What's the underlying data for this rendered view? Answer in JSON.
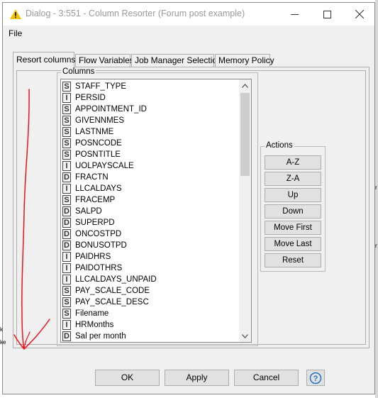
{
  "window": {
    "title": "Dialog - 3:551 - Column Resorter (Forum post example)"
  },
  "menu": {
    "file_label": "File"
  },
  "tabs": [
    {
      "label": "Resort columns",
      "active": true
    },
    {
      "label": "Flow Variables",
      "active": false
    },
    {
      "label": "Job Manager Selection",
      "active": false
    },
    {
      "label": "Memory Policy",
      "active": false
    }
  ],
  "columns_group": {
    "legend": "Columns"
  },
  "columns": [
    {
      "type": "S",
      "name": "STAFF_TYPE"
    },
    {
      "type": "I",
      "name": "PERSID"
    },
    {
      "type": "S",
      "name": "APPOINTMENT_ID"
    },
    {
      "type": "S",
      "name": "GIVENNMES"
    },
    {
      "type": "S",
      "name": "LASTNME"
    },
    {
      "type": "S",
      "name": "POSNCODE"
    },
    {
      "type": "S",
      "name": "POSNTITLE"
    },
    {
      "type": "I",
      "name": "UOLPAYSCALE"
    },
    {
      "type": "D",
      "name": "FRACTN"
    },
    {
      "type": "I",
      "name": "LLCALDAYS"
    },
    {
      "type": "S",
      "name": "FRACEMP"
    },
    {
      "type": "D",
      "name": "SALPD"
    },
    {
      "type": "D",
      "name": "SUPERPD"
    },
    {
      "type": "D",
      "name": "ONCOSTPD"
    },
    {
      "type": "D",
      "name": "BONUSOTPD"
    },
    {
      "type": "I",
      "name": "PAIDHRS"
    },
    {
      "type": "I",
      "name": "PAIDOTHRS"
    },
    {
      "type": "I",
      "name": "LLCALDAYS_UNPAID"
    },
    {
      "type": "S",
      "name": "PAY_SCALE_CODE"
    },
    {
      "type": "S",
      "name": "PAY_SCALE_DESC"
    },
    {
      "type": "S",
      "name": "Filename"
    },
    {
      "type": "I",
      "name": "HRMonths"
    },
    {
      "type": "D",
      "name": "Sal per month"
    }
  ],
  "actions_group": {
    "legend": "Actions"
  },
  "actions": [
    "A-Z",
    "Z-A",
    "Up",
    "Down",
    "Move First",
    "Move Last",
    "Reset"
  ],
  "buttons": {
    "ok": "OK",
    "apply": "Apply",
    "cancel": "Cancel"
  },
  "background_fragments": [
    "k",
    "ke",
    "r",
    "r"
  ],
  "colors": {
    "annotation": "#e8141a",
    "warning_icon": "#f5c400"
  }
}
